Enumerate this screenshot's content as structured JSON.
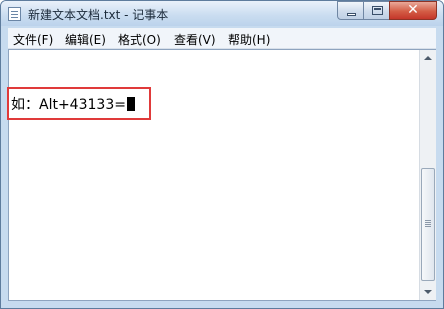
{
  "window": {
    "title": "新建文本文档.txt - 记事本",
    "close_glyph": "✕"
  },
  "menu": {
    "items": [
      {
        "label": "文件(F)"
      },
      {
        "label": "编辑(E)"
      },
      {
        "label": "格式(O)"
      },
      {
        "label": "查看(V)"
      },
      {
        "label": "帮助(H)"
      }
    ]
  },
  "editor": {
    "content": "如：Alt+43133="
  },
  "colors": {
    "highlight_border": "#e03a3a",
    "close_button": "#c4372a"
  },
  "icons": {
    "app": "notepad-icon",
    "minimize": "minimize-icon",
    "maximize": "maximize-icon",
    "close": "close-icon"
  }
}
